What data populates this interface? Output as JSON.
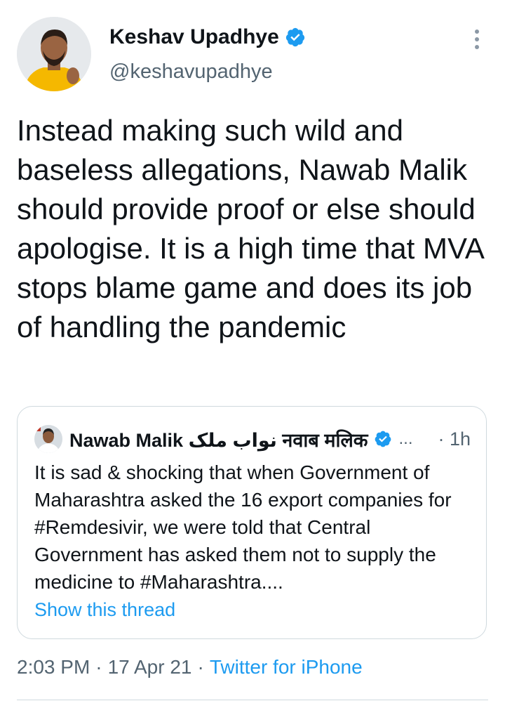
{
  "author": {
    "display_name": "Keshav Upadhye",
    "handle": "@keshavupadhye",
    "verified": true,
    "avatar_icon": "profile-photo"
  },
  "tweet": {
    "text": "Instead making such wild and baseless allegations, Nawab Malik should provide proof or else should apologise. It is a high time that MVA stops blame game and does its job of handling the pandemic"
  },
  "quoted": {
    "display_name": "Nawab Malik نواب ملک नवाब मलिक",
    "verified": true,
    "ellipsis": "...",
    "time": "· 1h",
    "text": "It is sad & shocking that when Government of Maharashtra asked the 16 export companies for #Remdesivir, we were told that Central Government has asked them not to supply the medicine to #Maharashtra....",
    "show_thread": "Show this thread"
  },
  "meta": {
    "time": "2:03 PM",
    "separator": "·",
    "date": "17 Apr 21",
    "source": "Twitter for iPhone"
  },
  "colors": {
    "accent": "#1d9bf0",
    "text": "#0f1419",
    "muted": "#536471",
    "border": "#cfd9de",
    "avatar_bg": "#f5c518"
  }
}
